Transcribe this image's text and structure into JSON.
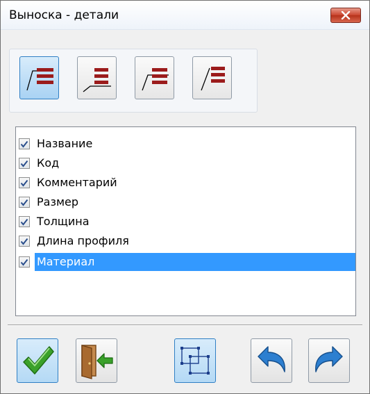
{
  "window": {
    "title": "Выноска - детали",
    "close_icon": "close-x-icon"
  },
  "alignment": {
    "buttons": [
      {
        "icon": "leader-slash-top-icon",
        "active": true
      },
      {
        "icon": "leader-underline-bottom-icon",
        "active": false
      },
      {
        "icon": "leader-slash-middle-icon",
        "active": false
      },
      {
        "icon": "leader-slash-plain-icon",
        "active": false
      }
    ]
  },
  "fields": {
    "items": [
      {
        "label": "Название",
        "checked": true,
        "selected": false
      },
      {
        "label": "Код",
        "checked": true,
        "selected": false
      },
      {
        "label": "Комментарий",
        "checked": true,
        "selected": false
      },
      {
        "label": "Размер",
        "checked": true,
        "selected": false
      },
      {
        "label": "Толщина",
        "checked": true,
        "selected": false
      },
      {
        "label": "Длина профиля",
        "checked": true,
        "selected": false
      },
      {
        "label": "Материал",
        "checked": true,
        "selected": true
      }
    ]
  },
  "actions": {
    "ok_icon": "checkmark-icon",
    "exit_icon": "exit-door-icon",
    "select_icon": "selection-frame-icon",
    "undo_icon": "undo-arrow-icon",
    "redo_icon": "redo-arrow-icon"
  },
  "colors": {
    "selection": "#3399ff",
    "active_button": "#a9d2f3",
    "leader_bars": "#9b1b1b",
    "ok_green": "#3aa12a",
    "arrow_blue": "#2d7fd0"
  }
}
